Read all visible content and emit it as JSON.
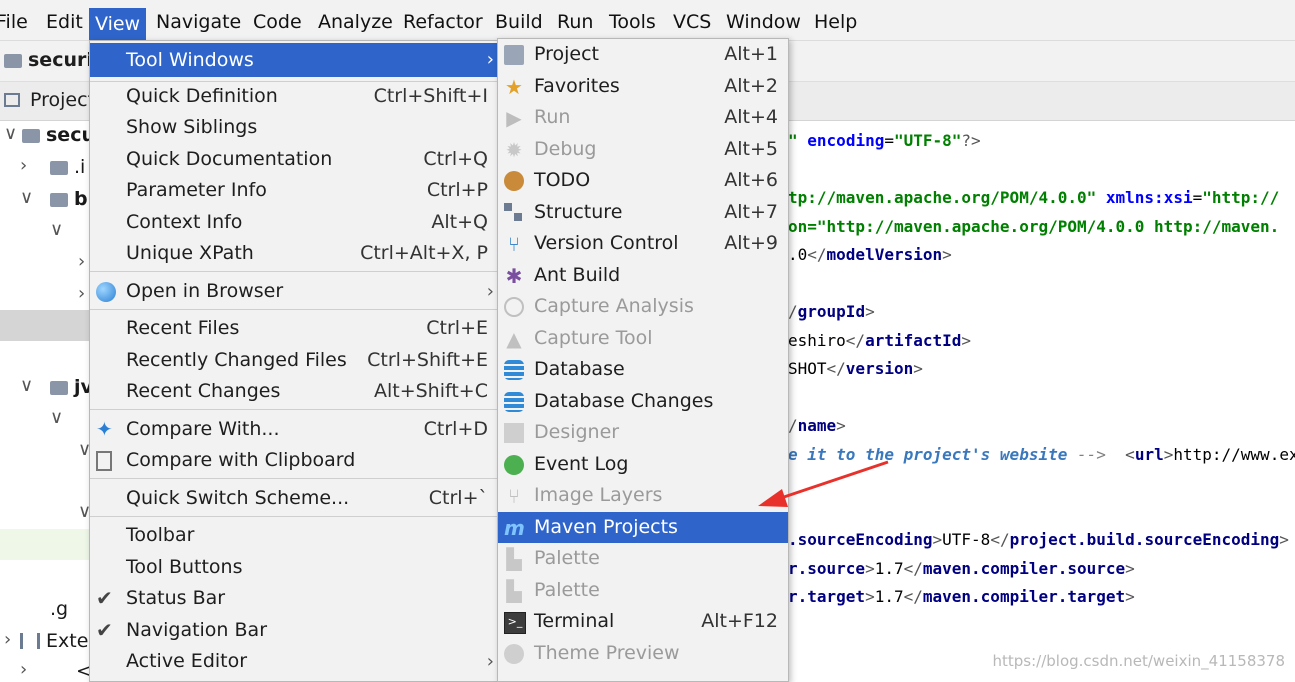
{
  "menubar": {
    "items": [
      "File",
      "Edit",
      "View",
      "Navigate",
      "Code",
      "Analyze",
      "Refactor",
      "Build",
      "Run",
      "Tools",
      "VCS",
      "Window",
      "Help"
    ],
    "active": "View"
  },
  "ide": {
    "project_label": "securit",
    "panel_tab": "Project",
    "tree": [
      "secur",
      ".i",
      "b",
      "jv",
      ".g",
      "Exter",
      "<"
    ]
  },
  "view_menu": {
    "items": [
      {
        "label": "Tool Windows",
        "shortcut": "",
        "submenu": true,
        "highlight": true
      },
      {
        "label": "Quick Definition",
        "shortcut": "Ctrl+Shift+I"
      },
      {
        "label": "Show Siblings",
        "shortcut": ""
      },
      {
        "label": "Quick Documentation",
        "shortcut": "Ctrl+Q"
      },
      {
        "label": "Parameter Info",
        "shortcut": "Ctrl+P"
      },
      {
        "label": "Context Info",
        "shortcut": "Alt+Q"
      },
      {
        "label": "Unique XPath",
        "shortcut": "Ctrl+Alt+X, P"
      },
      {
        "label": "Open in Browser",
        "shortcut": "",
        "submenu": true,
        "icon": "globe-icon"
      },
      {
        "label": "Recent Files",
        "shortcut": "Ctrl+E"
      },
      {
        "label": "Recently Changed Files",
        "shortcut": "Ctrl+Shift+E"
      },
      {
        "label": "Recent Changes",
        "shortcut": "Alt+Shift+C"
      },
      {
        "label": "Compare With...",
        "shortcut": "Ctrl+D",
        "icon": "compare-icon"
      },
      {
        "label": "Compare with Clipboard",
        "shortcut": "",
        "icon": "compare-clipboard-icon"
      },
      {
        "label": "Quick Switch Scheme...",
        "shortcut": "Ctrl+`"
      },
      {
        "label": "Toolbar",
        "shortcut": ""
      },
      {
        "label": "Tool Buttons",
        "shortcut": ""
      },
      {
        "label": "Status Bar",
        "shortcut": "",
        "checked": true
      },
      {
        "label": "Navigation Bar",
        "shortcut": "",
        "checked": true
      },
      {
        "label": "Active Editor",
        "shortcut": "",
        "submenu": true
      }
    ]
  },
  "tool_windows_menu": {
    "items": [
      {
        "label": "Project",
        "shortcut": "Alt+1",
        "icon": "project-icon"
      },
      {
        "label": "Favorites",
        "shortcut": "Alt+2",
        "icon": "star-icon"
      },
      {
        "label": "Run",
        "shortcut": "Alt+4",
        "icon": "run-icon",
        "disabled": true
      },
      {
        "label": "Debug",
        "shortcut": "Alt+5",
        "icon": "debug-icon",
        "disabled": true
      },
      {
        "label": "TODO",
        "shortcut": "Alt+6",
        "icon": "todo-icon"
      },
      {
        "label": "Structure",
        "shortcut": "Alt+7",
        "icon": "structure-icon"
      },
      {
        "label": "Version Control",
        "shortcut": "Alt+9",
        "icon": "version-control-icon"
      },
      {
        "label": "Ant Build",
        "shortcut": "",
        "icon": "ant-icon"
      },
      {
        "label": "Capture Analysis",
        "shortcut": "",
        "icon": "capture-analysis-icon",
        "disabled": true
      },
      {
        "label": "Capture Tool",
        "shortcut": "",
        "icon": "capture-tool-icon",
        "disabled": true
      },
      {
        "label": "Database",
        "shortcut": "",
        "icon": "database-icon"
      },
      {
        "label": "Database Changes",
        "shortcut": "",
        "icon": "database-changes-icon"
      },
      {
        "label": "Designer",
        "shortcut": "",
        "icon": "designer-icon",
        "disabled": true
      },
      {
        "label": "Event Log",
        "shortcut": "",
        "icon": "event-log-icon"
      },
      {
        "label": "Image Layers",
        "shortcut": "",
        "icon": "image-layers-icon",
        "disabled": true
      },
      {
        "label": "Maven Projects",
        "shortcut": "",
        "icon": "maven-icon",
        "highlight": true
      },
      {
        "label": "Palette",
        "shortcut": "",
        "icon": "palette-icon",
        "disabled": true
      },
      {
        "label": "Palette",
        "shortcut": "",
        "icon": "palette-icon",
        "disabled": true
      },
      {
        "label": "Terminal",
        "shortcut": "Alt+F12",
        "icon": "terminal-icon"
      },
      {
        "label": "Theme Preview",
        "shortcut": "",
        "icon": "theme-preview-icon",
        "disabled": true
      }
    ]
  },
  "editor": {
    "lines": [
      "\" encoding=\"UTF-8\"?>",
      "tp://maven.apache.org/POM/4.0.0\" xmlns:xsi=\"http://",
      "on=\"http://maven.apache.org/POM/4.0.0 http://maven.",
      ".0</modelVersion>",
      "/groupId>",
      "eshiro</artifactId>",
      "SHOT</version>",
      "/name>",
      "e it to the project's website -->  <url>http://www.ex",
      ".sourceEncoding>UTF-8</project.build.sourceEncoding>",
      "r.source>1.7</maven.compiler.source>",
      "r.target>1.7</maven.compiler.target>"
    ]
  },
  "watermark": "https://blog.csdn.net/weixin_41158378",
  "colors": {
    "highlight": "#2f65ca",
    "arrow": "#e8312a",
    "menu_bg": "#f2f2f2"
  }
}
